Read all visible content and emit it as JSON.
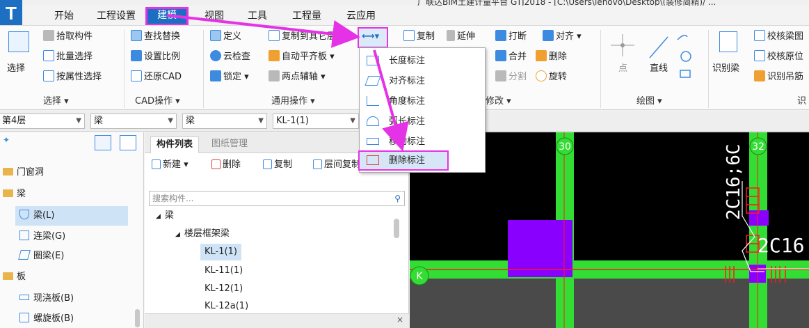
{
  "app": {
    "logo_letter": "T",
    "title": "广联达BIM土建计量平台 GTJ2018 - [C:\\Users\\lenovo\\Desktop\\(装修简精)/ ..."
  },
  "menu": {
    "tabs": [
      "开始",
      "工程设置",
      "建模",
      "视图",
      "工具",
      "工程量",
      "云应用"
    ],
    "active_index": 2
  },
  "ribbon": {
    "select_group": {
      "big_button": "选择",
      "items": [
        "拾取构件",
        "批量选择",
        "按属性选择"
      ],
      "label": "选择 ▾"
    },
    "cad_group": {
      "items": [
        "查找替换",
        "设置比例",
        "还原CAD"
      ],
      "label": "CAD操作 ▾"
    },
    "common_group": {
      "items": [
        "定义",
        "云检查",
        "锁定 ▾",
        "复制到其它层 ▾",
        "自动平齐板 ▾",
        "两点辅轴 ▾"
      ],
      "label": "通用操作 ▾"
    },
    "dimension_button": "▾",
    "modify_group": {
      "items": [
        "复制",
        "延伸",
        "打断",
        "对齐 ▾",
        "合并",
        "删除",
        "分割",
        "旋转"
      ],
      "label": "修改 ▾"
    },
    "draw_group": {
      "items": [
        "点",
        "直线"
      ],
      "label": "绘图 ▾"
    },
    "recognize_group": {
      "items": [
        "识别梁",
        "校核梁图",
        "校核原位",
        "识别吊筋"
      ],
      "label": "识"
    }
  },
  "dropdown": {
    "items": [
      "长度标注",
      "对齐标注",
      "角度标注",
      "弧长标注",
      "移动标注",
      "删除标注"
    ],
    "highlight_index": 5
  },
  "toolbar2": {
    "floor": "第4层",
    "category": "梁",
    "type": "梁",
    "component": "KL-1(1)"
  },
  "left_tree": {
    "items": [
      {
        "label": "门窗洞",
        "level": 0
      },
      {
        "label": "梁",
        "level": 0
      },
      {
        "label": "梁(L)",
        "level": 1
      },
      {
        "label": "连梁(G)",
        "level": 1
      },
      {
        "label": "圈梁(E)",
        "level": 1
      },
      {
        "label": "板",
        "level": 0
      },
      {
        "label": "现浇板(B)",
        "level": 1
      },
      {
        "label": "螺旋板(B)",
        "level": 1
      }
    ],
    "selected_index": 2
  },
  "component_panel": {
    "tabs": [
      "构件列表",
      "图纸管理"
    ],
    "tools": [
      "新建 ▾",
      "删除",
      "复制",
      "层间复制",
      "»"
    ],
    "search_placeholder": "搜索构件...",
    "tree": [
      {
        "label": "梁",
        "level": 0
      },
      {
        "label": "楼层框架梁",
        "level": 1
      },
      {
        "label": "KL-1(1)",
        "level": 2
      },
      {
        "label": "KL-11(1)",
        "level": 2
      },
      {
        "label": "KL-12(1)",
        "level": 2
      },
      {
        "label": "KL-12a(1)",
        "level": 2
      }
    ],
    "selected_index": 2,
    "footer_close": "×"
  },
  "canvas": {
    "axis_labels": [
      "30",
      "32",
      "K"
    ],
    "annotations": [
      "2C16;6C",
      "2C16"
    ]
  },
  "colors": {
    "accent": "#1b6ec2",
    "highlight": "#e632e6",
    "green": "#33dd33",
    "purple": "#8a00ff",
    "red": "#ff1a1a"
  }
}
